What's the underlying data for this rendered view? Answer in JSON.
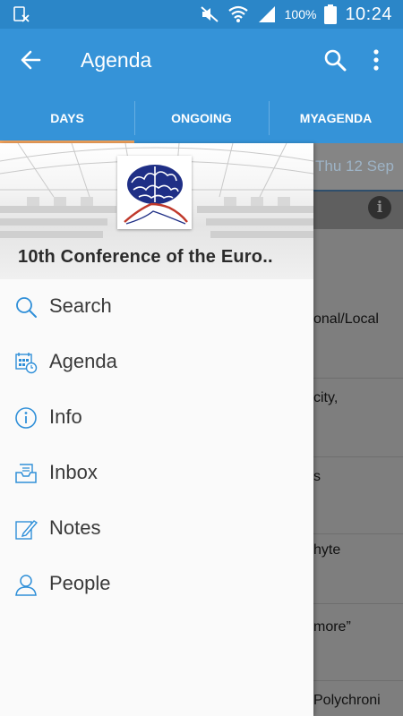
{
  "status_bar": {
    "battery": "100%",
    "time": "10:24"
  },
  "app_bar": {
    "title": "Agenda"
  },
  "tabs": [
    {
      "label": "DAYS",
      "active": true
    },
    {
      "label": "ONGOING",
      "active": false
    },
    {
      "label": "MYAGENDA",
      "active": false
    }
  ],
  "background": {
    "date": "Thu 12 Sep",
    "items": [
      "onal/Local",
      "city,",
      "s",
      "hyte",
      "more”",
      "Polychroni"
    ]
  },
  "drawer": {
    "title": "10th Conference of the Euro..",
    "items": [
      {
        "label": "Search",
        "icon": "search-icon"
      },
      {
        "label": "Agenda",
        "icon": "calendar-icon"
      },
      {
        "label": "Info",
        "icon": "info-icon"
      },
      {
        "label": "Inbox",
        "icon": "inbox-icon"
      },
      {
        "label": "Notes",
        "icon": "notes-icon"
      },
      {
        "label": "People",
        "icon": "person-icon"
      }
    ]
  },
  "colors": {
    "primary": "#3593d8",
    "status_bar": "#2b86c8",
    "tab_indicator": "#f2a25c",
    "icon_blue": "#2f8fd8"
  }
}
